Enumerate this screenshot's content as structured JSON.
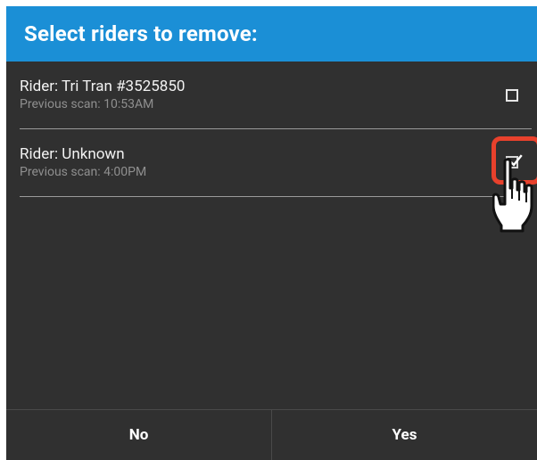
{
  "dialog": {
    "title": "Select riders to remove:",
    "header_color": "#1b8fd6",
    "background_color": "#303030"
  },
  "riders": [
    {
      "name": "Rider: Tri Tran #3525850",
      "previous_scan": "Previous scan: 10:53AM",
      "checked": false
    },
    {
      "name": "Rider: Unknown",
      "previous_scan": "Previous scan: 4:00PM",
      "checked": true
    }
  ],
  "highlight": {
    "color": "#e8412c",
    "target": "rider-2-checkbox"
  },
  "pointer": {
    "icon": "hand-pointer-icon"
  },
  "footer": {
    "no_label": "No",
    "yes_label": "Yes"
  }
}
